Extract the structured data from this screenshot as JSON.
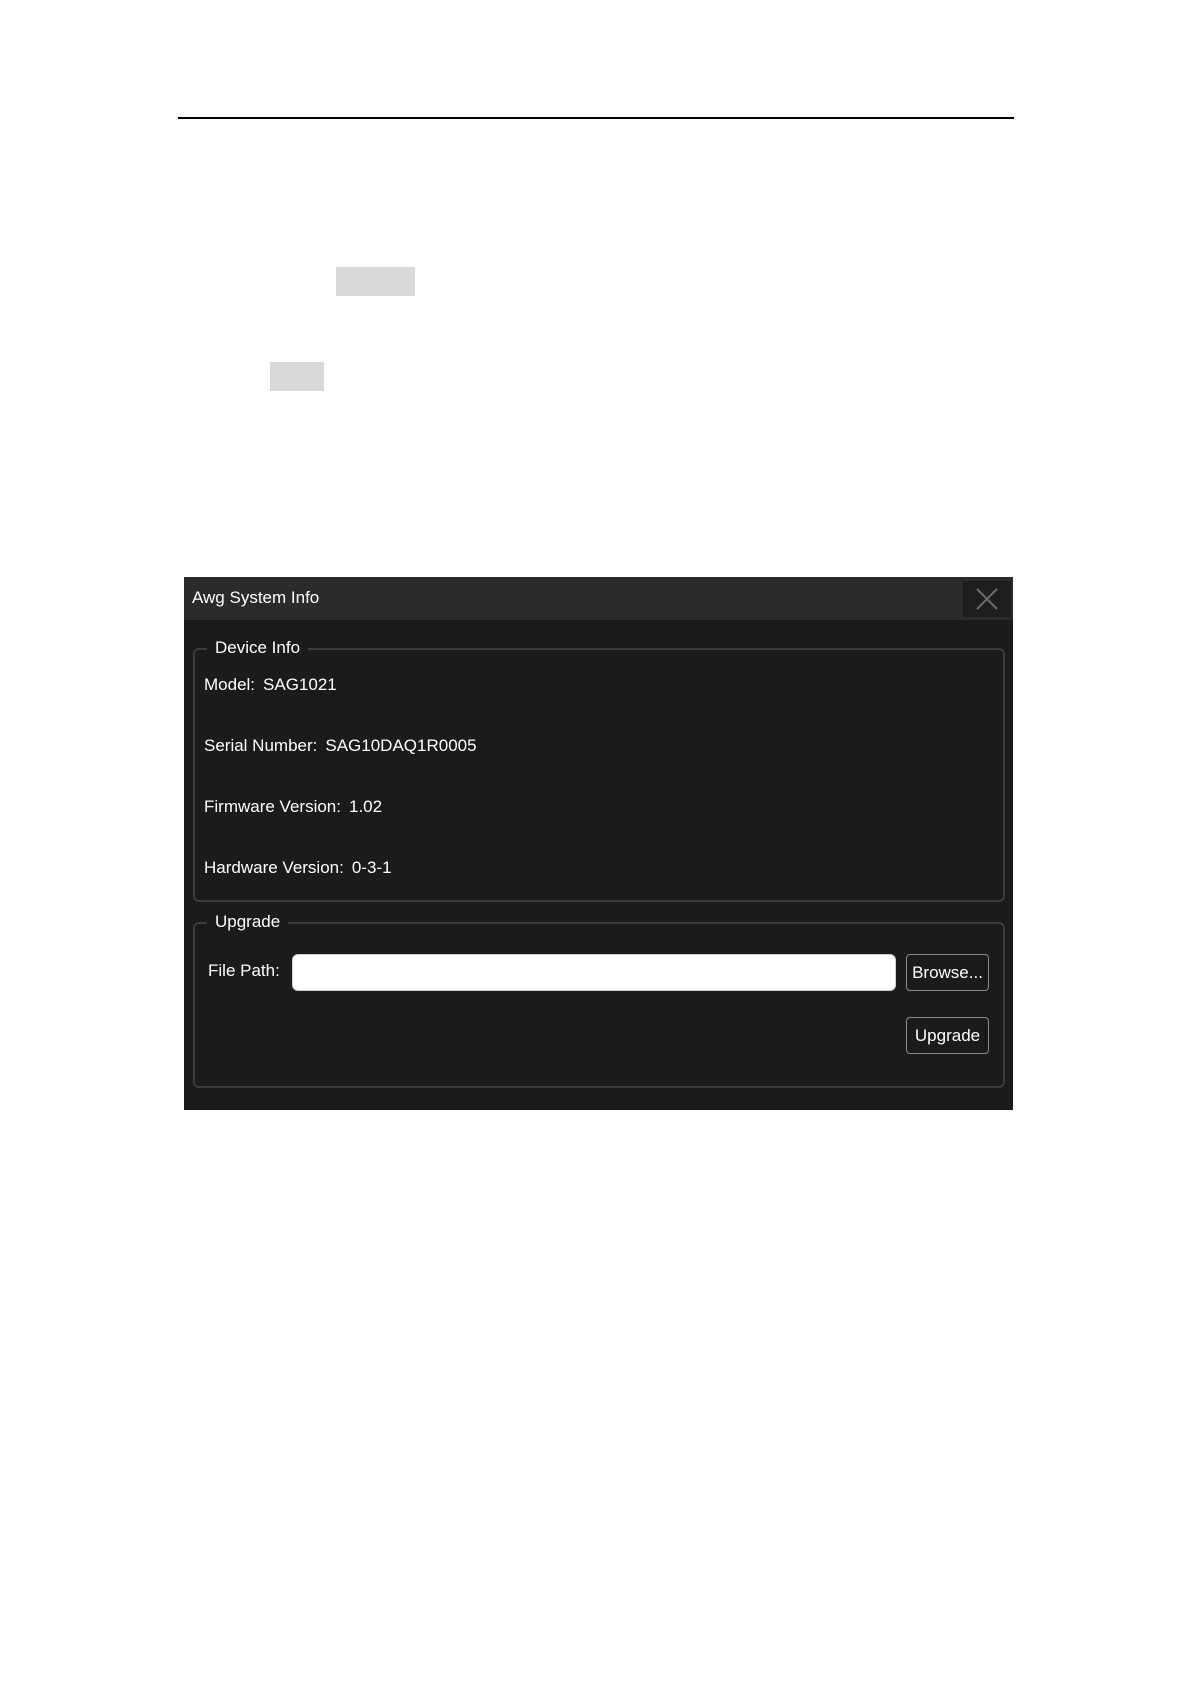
{
  "dialog": {
    "title": "Awg System Info",
    "close_icon": "close-icon"
  },
  "device_info": {
    "legend": "Device Info",
    "model_label": "Model:",
    "model_value": "SAG1021",
    "serial_label": "Serial Number:",
    "serial_value": "SAG10DAQ1R0005",
    "firmware_label": "Firmware Version:",
    "firmware_value": "1.02",
    "hardware_label": "Hardware Version:",
    "hardware_value": "0-3-1"
  },
  "upgrade": {
    "legend": "Upgrade",
    "file_path_label": "File Path:",
    "file_path_value": "",
    "browse_label": "Browse...",
    "upgrade_label": "Upgrade"
  },
  "colors": {
    "dialog_background": "#1b1b1b",
    "titlebar_background": "#2b2b2b",
    "text": "#ffffff",
    "group_border": "#3c3c3c"
  }
}
